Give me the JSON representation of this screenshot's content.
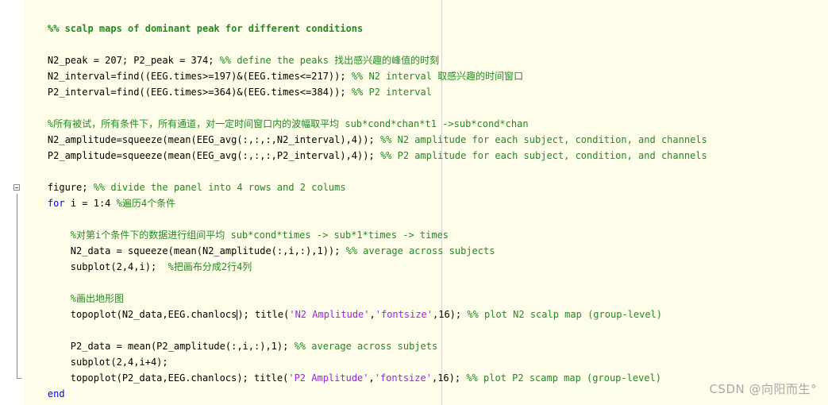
{
  "lines": {
    "l1": "%% scalp maps of dominant peak for different conditions",
    "l3": "N2_peak = 207; P2_peak = 374; ",
    "l3c": "%% define the peaks 找出感兴趣的峰值的时刻",
    "l4": "N2_interval=find((EEG.times>=197)&(EEG.times<=217)); ",
    "l4c": "%% N2 interval 取感兴趣的时间窗口",
    "l5": "P2_interval=find((EEG.times>=364)&(EEG.times<=384)); ",
    "l5c": "%% P2 interval",
    "l7c": "%所有被试，所有条件下，所有通道，对一定时间窗口内的波幅取平均 sub*cond*chan*t1 ->sub*cond*chan",
    "l8": "N2_amplitude=squeeze(mean(EEG_avg(:,:,:,N2_interval),4)); ",
    "l8c": "%% N2 amplitude for each subject, condition, and channels",
    "l9": "P2_amplitude=squeeze(mean(EEG_avg(:,:,:,P2_interval),4)); ",
    "l9c": "%% P2 amplitude for each subject, condition, and channels",
    "l11": "figure; ",
    "l11c": "%% divide the panel into 4 rows and 2 colums",
    "l12k": "for",
    "l12": " i = 1:4 ",
    "l12c": "%遍历4个条件",
    "l14c": "    %对第i个条件下的数据进行组间平均 sub*cond*times -> sub*1*times -> times",
    "l15": "    N2_data = squeeze(mean(N2_amplitude(:,i,:),1)); ",
    "l15c": "%% average across subjects",
    "l16": "    subplot(2,4,i);  ",
    "l16c": "%把画布分成2行4列",
    "l18c": "    %画出地形图",
    "l19a": "    topoplot(N2_data,EEG.chanlocs",
    "l19b": "); title(",
    "l19s1": "'N2 Amplitude'",
    "l19d": ",",
    "l19s2": "'fontsize'",
    "l19e": ",16); ",
    "l19c": "%% plot N2 scalp map (group-level)",
    "l21": "    P2_data = mean(P2_amplitude(:,i,:),1); ",
    "l21c": "%% average across subjets",
    "l22": "    subplot(2,4,i+4);",
    "l23a": "    topoplot(P2_data,EEG.chanlocs); title(",
    "l23s1": "'P2 Amplitude'",
    "l23d": ",",
    "l23s2": "'fontsize'",
    "l23e": ",16); ",
    "l23c": "%% plot P2 scamp map (group-level)",
    "l24k": "end"
  },
  "watermark": "CSDN @向阳而生°",
  "colors": {
    "comment": "#228b22",
    "keyword": "#0000ff",
    "string": "#a020f0",
    "background": "#fdfde9"
  }
}
